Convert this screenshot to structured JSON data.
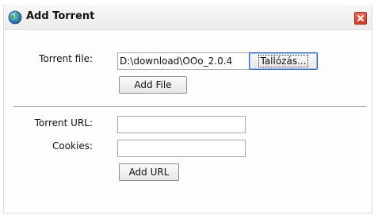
{
  "dialog": {
    "title": "Add Torrent",
    "icons": {
      "app": "globe-icon",
      "close": "close-icon"
    }
  },
  "torrent_file": {
    "label": "Torrent file:",
    "value": "D:\\download\\OOo_2.0.4",
    "browse_label": "Tallózás...",
    "add_button": "Add File"
  },
  "torrent_url": {
    "url_label": "Torrent URL:",
    "url_value": "",
    "cookies_label": "Cookies:",
    "cookies_value": "",
    "add_button": "Add URL"
  },
  "colors": {
    "close_button": "#e04a35",
    "browse_focus_border": "#2a62c9",
    "divider": "#9a9a9a"
  }
}
